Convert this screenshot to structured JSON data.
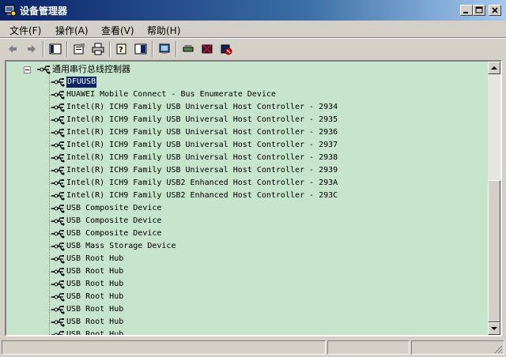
{
  "window": {
    "title": "设备管理器",
    "icon": "device-manager-icon"
  },
  "menu": {
    "items": [
      {
        "label": "文件(F)"
      },
      {
        "label": "操作(A)"
      },
      {
        "label": "查看(V)"
      },
      {
        "label": "帮助(H)"
      }
    ]
  },
  "toolbar": {
    "icons": [
      "back-arrow-icon",
      "forward-arrow-icon",
      "show-hide-tree-icon",
      "properties-icon",
      "print-icon",
      "help-icon",
      "console-view-icon",
      "scan-hardware-icon",
      "update-driver-icon",
      "uninstall-icon",
      "disable-device-icon"
    ]
  },
  "tree": {
    "category": {
      "label": "通用串行总线控制器",
      "icon": "usb-connector-icon",
      "expanded": true
    },
    "devices": [
      {
        "label": "DFUUSB",
        "selected": true
      },
      {
        "label": "HUAWEI Mobile Connect - Bus Enumerate Device"
      },
      {
        "label": "Intel(R) ICH9 Family USB Universal Host Controller - 2934"
      },
      {
        "label": "Intel(R) ICH9 Family USB Universal Host Controller - 2935"
      },
      {
        "label": "Intel(R) ICH9 Family USB Universal Host Controller - 2936"
      },
      {
        "label": "Intel(R) ICH9 Family USB Universal Host Controller - 2937"
      },
      {
        "label": "Intel(R) ICH9 Family USB Universal Host Controller - 2938"
      },
      {
        "label": "Intel(R) ICH9 Family USB Universal Host Controller - 2939"
      },
      {
        "label": "Intel(R) ICH9 Family USB2 Enhanced Host Controller - 293A"
      },
      {
        "label": "Intel(R) ICH9 Family USB2 Enhanced Host Controller - 293C"
      },
      {
        "label": "USB Composite Device"
      },
      {
        "label": "USB Composite Device"
      },
      {
        "label": "USB Composite Device"
      },
      {
        "label": "USB Mass Storage Device"
      },
      {
        "label": "USB Root Hub"
      },
      {
        "label": "USB Root Hub"
      },
      {
        "label": "USB Root Hub"
      },
      {
        "label": "USB Root Hub"
      },
      {
        "label": "USB Root Hub"
      },
      {
        "label": "USB Root Hub"
      },
      {
        "label": "USB Root Hub"
      }
    ]
  },
  "colors": {
    "title_active": "#0a246a",
    "tree_background": "#c7e4cc",
    "selection": "#0a246a",
    "chrome": "#d4d0c8"
  }
}
